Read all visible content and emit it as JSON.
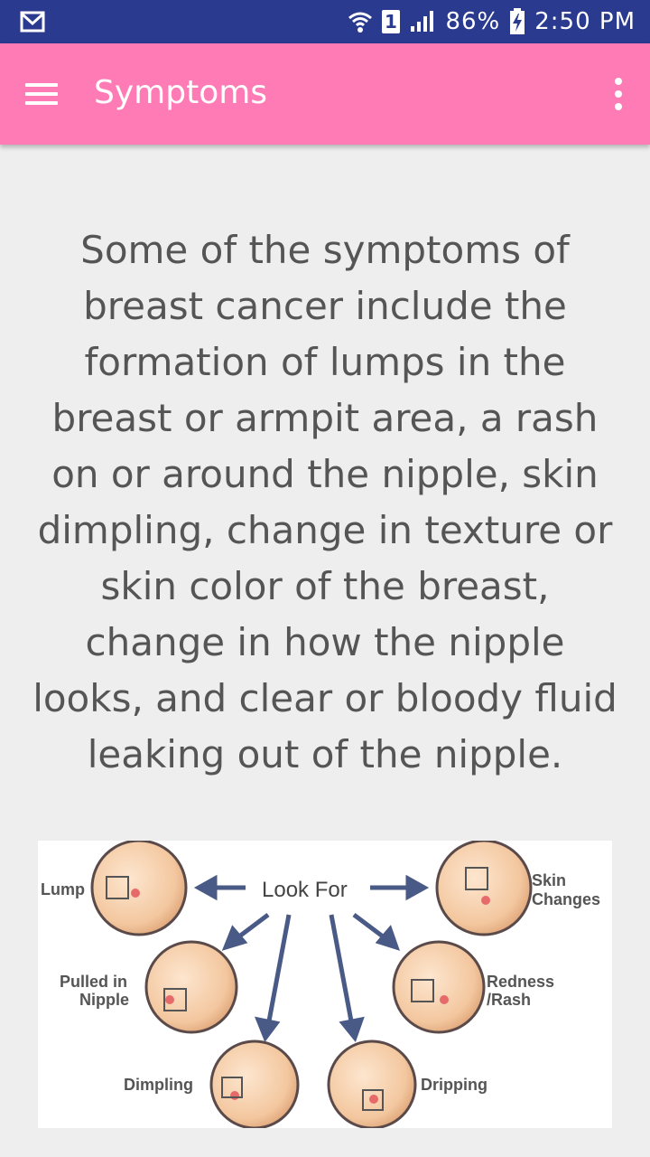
{
  "status_bar": {
    "battery": "86%",
    "time": "2:50 PM",
    "sim": "1"
  },
  "toolbar": {
    "title": "Symptoms",
    "menu_icon": "hamburger-menu-icon",
    "more_icon": "overflow-more-icon"
  },
  "content": {
    "text": "Some of the symptoms of breast cancer include the formation of lumps in the breast or armpit area, a rash on or around the nipple, skin dimpling, change in texture or skin color of the breast, change in how the nipple looks, and clear or bloody fluid leaking out of the nipple."
  },
  "diagram": {
    "center_label": "Look For",
    "labels": {
      "lump": "Lump",
      "skin_changes_1": "Skin",
      "skin_changes_2": "Changes",
      "pulled_1": "Pulled in",
      "pulled_2": "Nipple",
      "redness_1": "Redness",
      "redness_2": "/Rash",
      "dimpling": "Dimpling",
      "dripping": "Dripping"
    }
  },
  "colors": {
    "status_bar": "#2a3a8f",
    "toolbar": "#ff7bb5",
    "background": "#eeeeee",
    "text": "#555555"
  }
}
